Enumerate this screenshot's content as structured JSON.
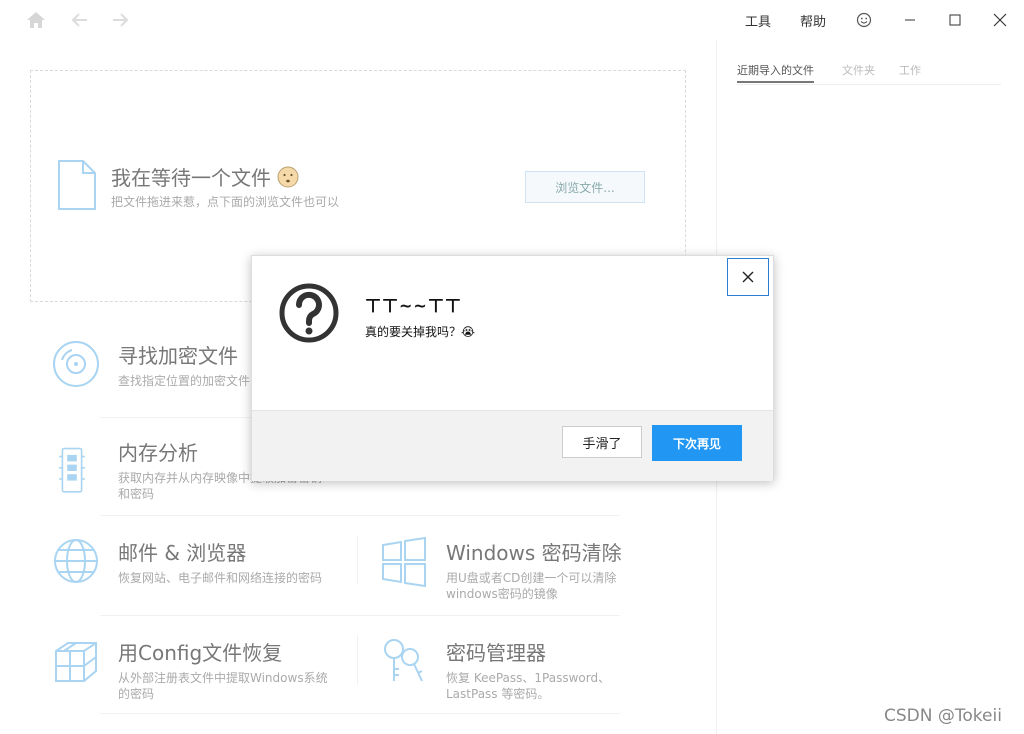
{
  "titlebar": {
    "menu_tools": "工具",
    "menu_help": "帮助"
  },
  "right_panel": {
    "tabs": [
      "近期导入的文件",
      "文件夹",
      "工作"
    ]
  },
  "dropzone": {
    "title": "我在等待一个文件",
    "subtitle": "把文件拖进来惹，点下面的浏览文件也可以",
    "browse_label": "浏览文件..."
  },
  "tools": [
    {
      "title": "寻找加密文件",
      "desc": "查找指定位置的加密文件"
    },
    {
      "title": "内存分析",
      "desc": "获取内存并从内存映像中提取加密密钥和密码"
    },
    {
      "title": "邮件 & 浏览器",
      "desc": "恢复网站、电子邮件和网络连接的密码"
    },
    {
      "title": "Windows 密码清除",
      "desc": "用U盘或者CD创建一个可以清除windows密码的镜像"
    },
    {
      "title": "用Config文件恢复",
      "desc": "从外部注册表文件中提取Windows系统的密码"
    },
    {
      "title": "密码管理器",
      "desc": "恢复 KeePass、1Password、LastPass 等密码。"
    }
  ],
  "dialog": {
    "title": "ㄒㄒ~~ㄒㄒ",
    "message": "真的要关掉我吗？😭",
    "cancel_label": "手滑了",
    "confirm_label": "下次再见"
  },
  "watermark": "CSDN @Tokeii",
  "colors": {
    "accent": "#2196f3",
    "icon_blue": "#a9d4f2",
    "close_border": "#2a7fd4"
  }
}
